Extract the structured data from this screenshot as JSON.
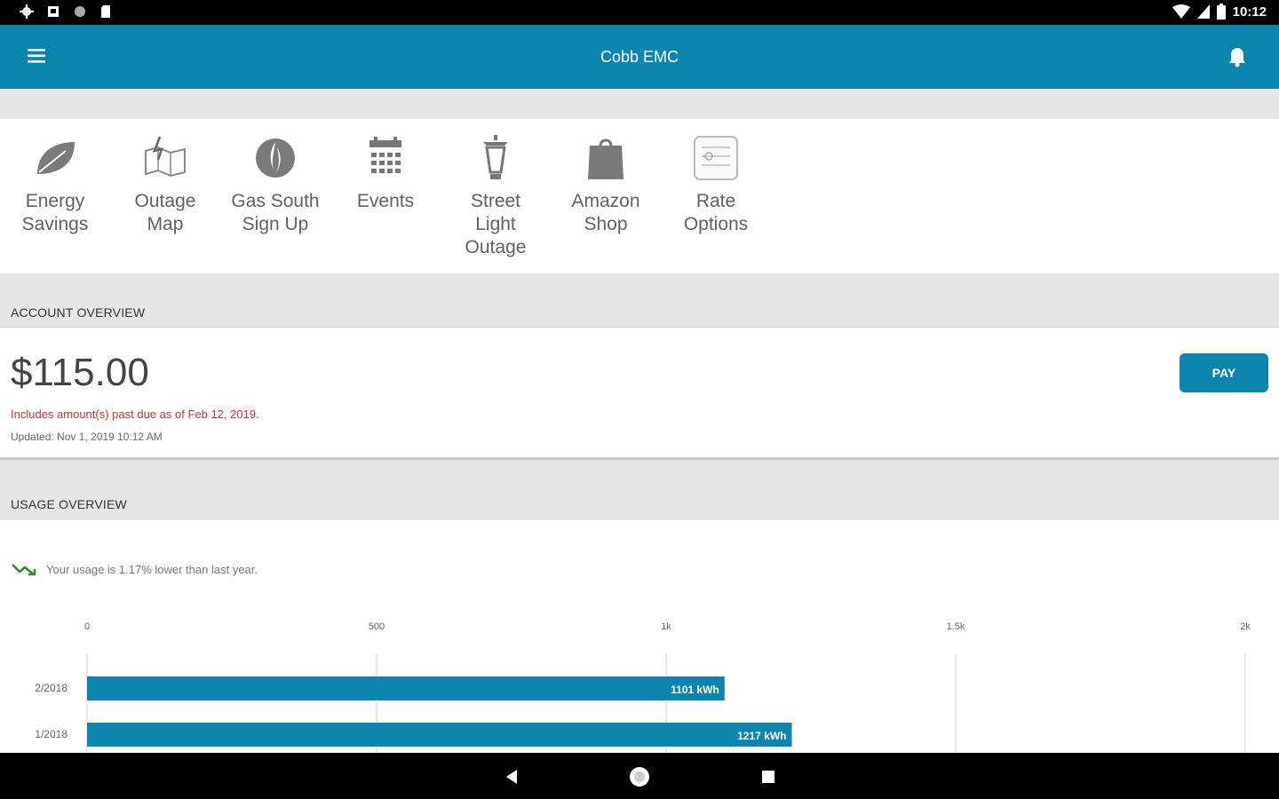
{
  "status_bar": {
    "time": "10:12",
    "icons": [
      "settings-icon",
      "photo-icon",
      "circle-icon",
      "sdcard-icon",
      "wifi-icon",
      "signal-icon",
      "battery-icon"
    ]
  },
  "app_bar": {
    "title": "Cobb EMC",
    "menu_icon": "menu-icon",
    "bell_icon": "bell-icon",
    "color": "#0b85ae"
  },
  "quick_links": [
    {
      "label": "Energy\nSavings",
      "icon": "leaf-icon"
    },
    {
      "label": "Outage\nMap",
      "icon": "map-icon"
    },
    {
      "label": "Gas South\nSign Up",
      "icon": "gas-flame-icon"
    },
    {
      "label": "Events",
      "icon": "calendar-icon"
    },
    {
      "label": "Street\nLight\nOutage",
      "icon": "street-light-icon"
    },
    {
      "label": "Amazon\nShop",
      "icon": "shopping-bag-icon"
    },
    {
      "label": "Rate\nOptions",
      "icon": "rate-options-icon"
    }
  ],
  "account_overview": {
    "heading": "ACCOUNT OVERVIEW",
    "amount": "$115.00",
    "past_due_note": "Includes amount(s) past due as of Feb 12, 2019.",
    "updated": "Updated:  Nov 1, 2019 10:12 AM",
    "pay_label": "PAY",
    "past_due_color": "#d32f2f"
  },
  "usage_overview": {
    "heading": "USAGE OVERVIEW",
    "trend_text": "Your usage is 1.17% lower than last year.",
    "trend_icon": "trending-down-icon",
    "trend_color": "#2e8b2e"
  },
  "chart_data": {
    "type": "bar",
    "orientation": "horizontal",
    "categories": [
      "2/2018",
      "1/2018"
    ],
    "values": [
      1101,
      1217
    ],
    "value_labels": [
      "1101 kWh",
      "1217 kWh"
    ],
    "x_ticks": [
      0,
      500,
      1000,
      1500,
      2000
    ],
    "x_tick_labels": [
      "0",
      "500",
      "1k",
      "1.5k",
      "2k"
    ],
    "xlim": [
      0,
      2000
    ],
    "grid": true,
    "bar_color": "#0b85ae"
  },
  "nav_bar": {
    "icons": [
      "back-icon",
      "home-icon",
      "recents-icon"
    ]
  }
}
